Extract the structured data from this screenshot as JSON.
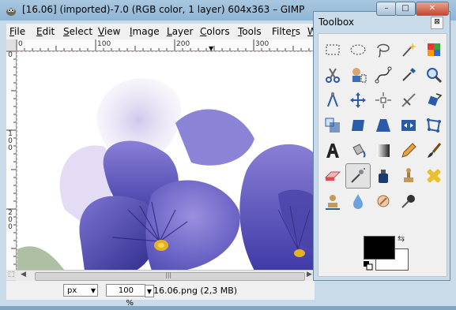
{
  "window": {
    "title": "[16.06] (imported)-7.0 (RGB color, 1 layer) 604x363 – GIMP",
    "minimize": "–",
    "maximize": "□",
    "close": "✕"
  },
  "menu": [
    {
      "label": "File",
      "key": "F",
      "rest": "ile"
    },
    {
      "label": "Edit",
      "key": "E",
      "rest": "dit"
    },
    {
      "label": "Select",
      "key": "S",
      "rest": "elect"
    },
    {
      "label": "View",
      "key": "V",
      "rest": "iew"
    },
    {
      "label": "Image",
      "key": "I",
      "rest": "mage"
    },
    {
      "label": "Layer",
      "key": "L",
      "rest": "ayer"
    },
    {
      "label": "Colors",
      "key": "C",
      "rest": "olors"
    },
    {
      "label": "Tools",
      "key": "T",
      "rest": "ools"
    },
    {
      "label": "Filters",
      "key": "r",
      "pre": "Filte",
      "rest": "s"
    },
    {
      "label": "W",
      "key": "W",
      "rest": ""
    }
  ],
  "ruler": {
    "top": [
      "0",
      "100",
      "200",
      "300"
    ],
    "left": [
      "0",
      "100",
      "200"
    ]
  },
  "status": {
    "unit": "px",
    "zoom": "100 %",
    "file": "16.06.png (2,3 MB)"
  },
  "toolbox": {
    "title": "Toolbox",
    "close": "⊠",
    "tools": [
      "rect-select",
      "ellipse-select",
      "lasso",
      "fuzzy-select",
      "color-select",
      "scissors",
      "foreground-select",
      "paths",
      "color-picker",
      "zoom",
      "measure",
      "move",
      "align",
      "crop",
      "rotate",
      "scale",
      "shear",
      "perspective",
      "flip",
      "cage-transform",
      "text",
      "bucket-fill",
      "blend",
      "pencil",
      "paintbrush",
      "eraser",
      "airbrush",
      "ink",
      "clone",
      "heal",
      "perspective-clone",
      "blur",
      "smudge",
      "dodge-burn"
    ],
    "active_tool": "airbrush",
    "foreground": "#000000",
    "background": "#ffffff"
  }
}
